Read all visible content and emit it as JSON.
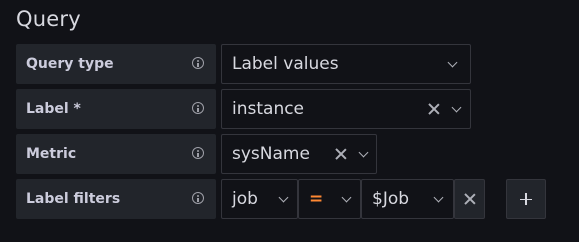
{
  "title": "Query",
  "rows": {
    "query_type": {
      "label": "Query type",
      "value": "Label values"
    },
    "label": {
      "label": "Label *",
      "value": "instance"
    },
    "metric": {
      "label": "Metric",
      "value": "sysName"
    },
    "label_filters": {
      "label": "Label filters",
      "filter": {
        "key": "job",
        "operator": "=",
        "value": "$Job"
      }
    }
  },
  "icons": {
    "info": "info-circle-icon",
    "chevron": "chevron-down-icon",
    "clear": "close-icon",
    "add": "plus-icon"
  },
  "colors": {
    "background": "#111217",
    "label_bg": "#22252b",
    "operator": "#ff8833"
  }
}
